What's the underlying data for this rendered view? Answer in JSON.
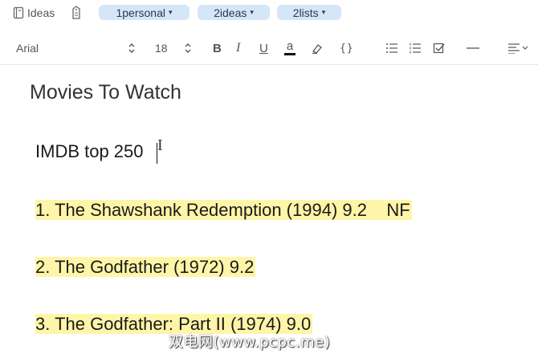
{
  "tagbar": {
    "notebook_label": "Ideas",
    "tags": [
      {
        "label": "1personal"
      },
      {
        "label": "2ideas"
      },
      {
        "label": "2lists"
      }
    ]
  },
  "toolbar": {
    "font_name": "Arial",
    "font_size": "18",
    "bold": "B",
    "italic": "I",
    "underline": "U",
    "text_color": "a",
    "code": "{}",
    "icons": [
      "up-down-arrows-icon",
      "bold-icon",
      "italic-icon",
      "underline-icon",
      "text-color-icon",
      "highlighter-icon",
      "code-block-icon",
      "bulleted-list-icon",
      "numbered-list-icon",
      "checklist-icon",
      "horizontal-rule-icon",
      "align-icon"
    ]
  },
  "note": {
    "title": "Movies To Watch",
    "intro": "IMDB top 250",
    "items": [
      "1. The Shawshank Redemption (1994) 9.2    NF",
      "2. The Godfather (1972) 9.2",
      "3. The Godfather: Part II (1974) 9.0"
    ],
    "highlight_color": "#fff5a8"
  },
  "watermark": "双电网(www.pcpc.me)"
}
